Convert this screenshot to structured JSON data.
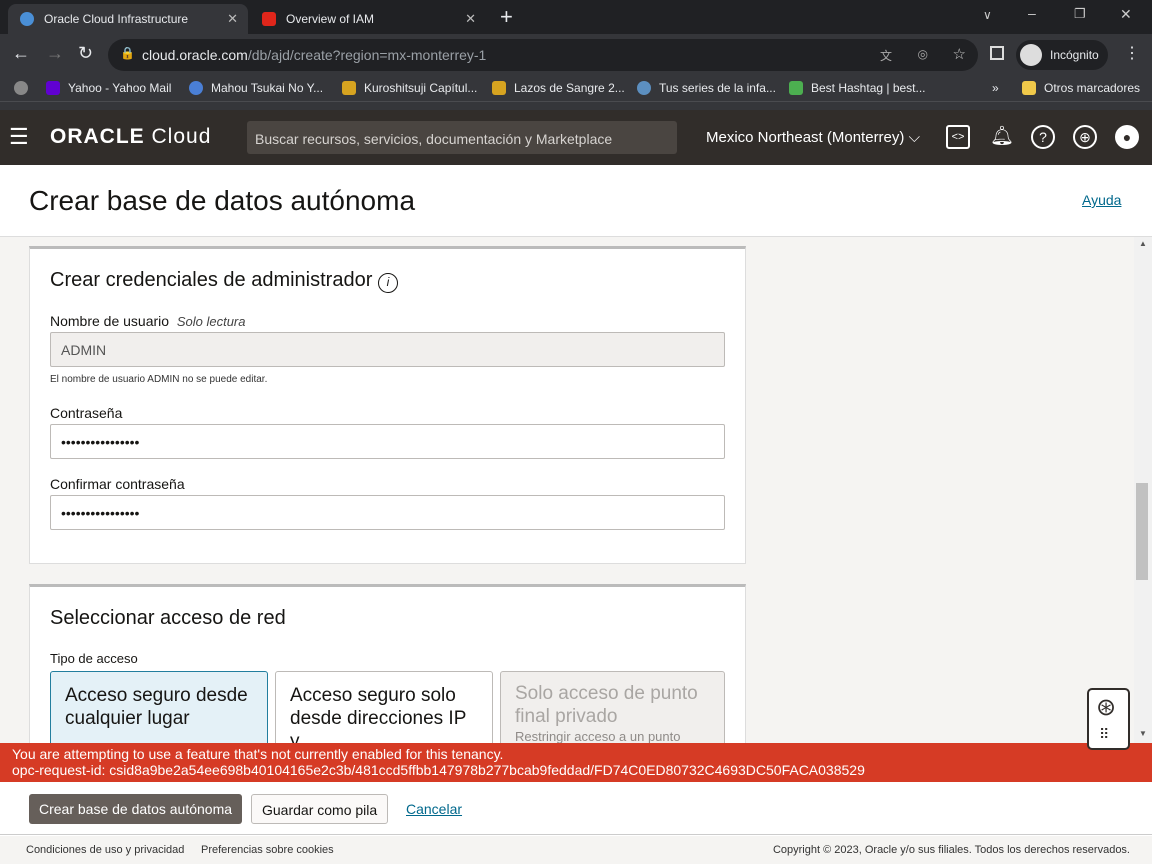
{
  "browser": {
    "tabs": [
      {
        "label": "Oracle Cloud Infrastructure",
        "active": true
      },
      {
        "label": "Overview of IAM",
        "active": false
      }
    ],
    "url_host": "cloud.oracle.com",
    "url_path": "/db/ajd/create?region=mx-monterrey-1",
    "profile": "Incógnito",
    "bookmarks": [
      "Yahoo - Yahoo Mail",
      "Mahou Tsukai No Y...",
      "Kuroshitsuji Capítul...",
      "Lazos de Sangre 2...",
      "Tus series de la infa...",
      "Best Hashtag | best..."
    ],
    "other_bookmarks": "Otros marcadores"
  },
  "header": {
    "logo_bold": "ORACLE",
    "logo_light": "Cloud",
    "search_placeholder": "Buscar recursos, servicios, documentación y Marketplace",
    "region": "Mexico Northeast (Monterrey)"
  },
  "page": {
    "title": "Crear base de datos autónoma",
    "help": "Ayuda"
  },
  "credentials": {
    "title": "Crear credenciales de administrador",
    "username_label": "Nombre de usuario",
    "readonly_label": "Solo lectura",
    "username_value": "ADMIN",
    "username_hint": "El nombre de usuario ADMIN no se puede editar.",
    "password_label": "Contraseña",
    "password_value": "••••••••••••••••",
    "confirm_label": "Confirmar contraseña",
    "confirm_value": "••••••••••••••••"
  },
  "network": {
    "title": "Seleccionar acceso de red",
    "access_type_label": "Tipo de acceso",
    "options": [
      {
        "label": "Acceso seguro desde cualquier lugar",
        "selected": true,
        "disabled": false
      },
      {
        "label": "Acceso seguro solo desde direcciones IP y",
        "selected": false,
        "disabled": false
      },
      {
        "label": "Solo acceso de punto final privado",
        "desc": "Restringir acceso a un punto",
        "selected": false,
        "disabled": true
      }
    ]
  },
  "error": {
    "message": "You are attempting to use a feature that's not currently enabled for this tenancy.",
    "request_id": "opc-request-id: csid8a9be2a54ee698b40104165e2c3b/481ccd5ffbb147978b277bcab9feddad/FD74C0ED80732C4693DC50FACA038529",
    "color": "#d63b25"
  },
  "actions": {
    "create": "Crear base de datos autónoma",
    "save_stack": "Guardar como pila",
    "cancel": "Cancelar"
  },
  "footer": {
    "terms": "Condiciones de uso y privacidad",
    "cookies": "Preferencias sobre cookies",
    "copyright": "Copyright © 2023, Oracle y/o sus filiales. Todos los derechos reservados."
  }
}
